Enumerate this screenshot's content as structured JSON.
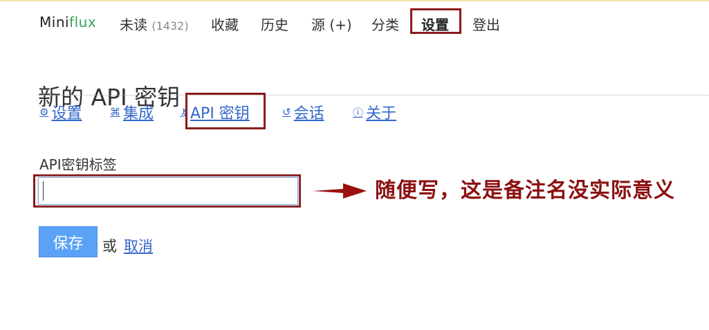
{
  "header": {
    "logo_prefix": "Mini",
    "logo_suffix": "flux",
    "nav": {
      "unread_label": "未读",
      "unread_count": "(1432)",
      "starred": "收藏",
      "history": "历史",
      "feeds": "源 (+)",
      "categories": "分类",
      "settings": "设置",
      "logout": "登出"
    }
  },
  "page": {
    "title": "新的 API 密钥"
  },
  "subnav": [
    {
      "label": "设置",
      "icon": "gear-icon"
    },
    {
      "label": "集成",
      "icon": "integration-icon"
    },
    {
      "label": "API 密钥",
      "icon": "key-icon"
    },
    {
      "label": "会话",
      "icon": "history-icon"
    },
    {
      "label": "关于",
      "icon": "info-icon"
    }
  ],
  "form": {
    "label": "API密钥标签",
    "value": "",
    "save_label": "保存",
    "or_text": "或",
    "cancel_label": "取消"
  },
  "annotation": {
    "text": "随便写，这是备注名没实际意义"
  },
  "colors": {
    "highlight_border": "#8b1a1a",
    "link": "#3366cc",
    "button": "#5aa2f6",
    "logo_accent": "#33a35a"
  }
}
